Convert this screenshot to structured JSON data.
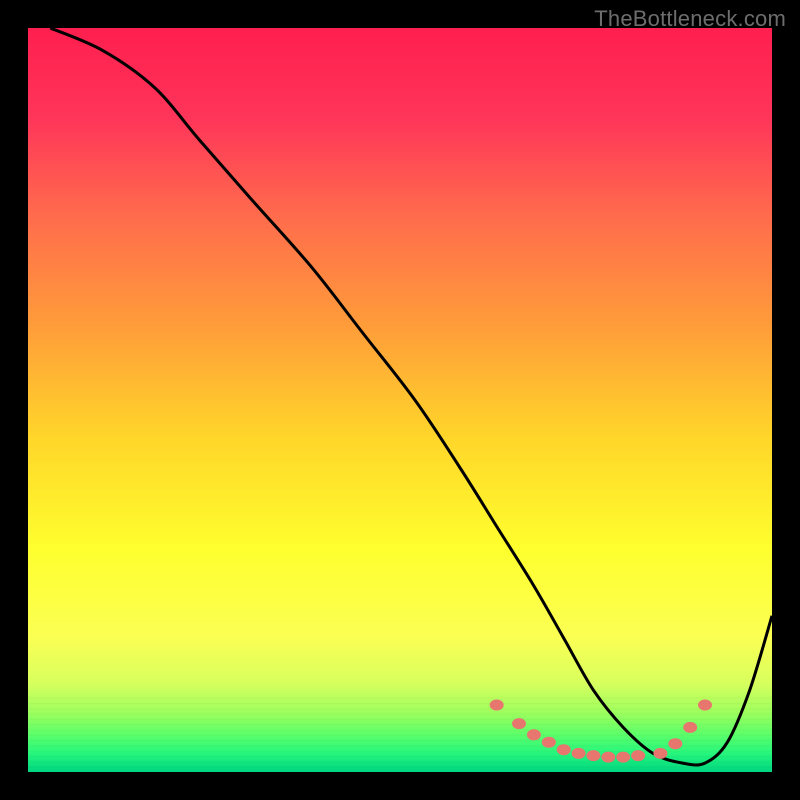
{
  "watermark": "TheBottleneck.com",
  "chart_data": {
    "type": "line",
    "title": "",
    "xlabel": "",
    "ylabel": "",
    "xlim": [
      0,
      100
    ],
    "ylim": [
      0,
      100
    ],
    "gradient_bands": [
      {
        "y": 0,
        "color": "#ff1f4f"
      },
      {
        "y": 12,
        "color": "#ff355a"
      },
      {
        "y": 25,
        "color": "#ff6b4d"
      },
      {
        "y": 40,
        "color": "#ff9d3a"
      },
      {
        "y": 55,
        "color": "#ffd62a"
      },
      {
        "y": 70,
        "color": "#ffff2e"
      },
      {
        "y": 82,
        "color": "#fbff54"
      },
      {
        "y": 88,
        "color": "#d8ff5e"
      },
      {
        "y": 92,
        "color": "#9eff5e"
      },
      {
        "y": 95,
        "color": "#5cff6b"
      },
      {
        "y": 97.5,
        "color": "#26f77d"
      },
      {
        "y": 100,
        "color": "#00d681"
      }
    ],
    "series": [
      {
        "name": "bottleneck-curve",
        "x": [
          3,
          10,
          17,
          23,
          30,
          38,
          45,
          52,
          58,
          63,
          68,
          72,
          76,
          80,
          84,
          88,
          91,
          94,
          97,
          100
        ],
        "y": [
          100,
          97,
          92,
          85,
          77,
          68,
          59,
          50,
          41,
          33,
          25,
          18,
          11,
          6,
          2.5,
          1.2,
          1.2,
          4,
          11,
          21
        ]
      }
    ],
    "markers": {
      "name": "highlight-dots",
      "x": [
        63,
        66,
        68,
        70,
        72,
        74,
        76,
        78,
        80,
        82,
        85,
        87,
        89,
        91
      ],
      "y": [
        9,
        6.5,
        5,
        4,
        3,
        2.5,
        2.2,
        2,
        2,
        2.2,
        2.5,
        3.8,
        6,
        9
      ]
    }
  },
  "colors": {
    "curve": "#000000",
    "dots": "#e7766e",
    "frame": "#000000"
  }
}
